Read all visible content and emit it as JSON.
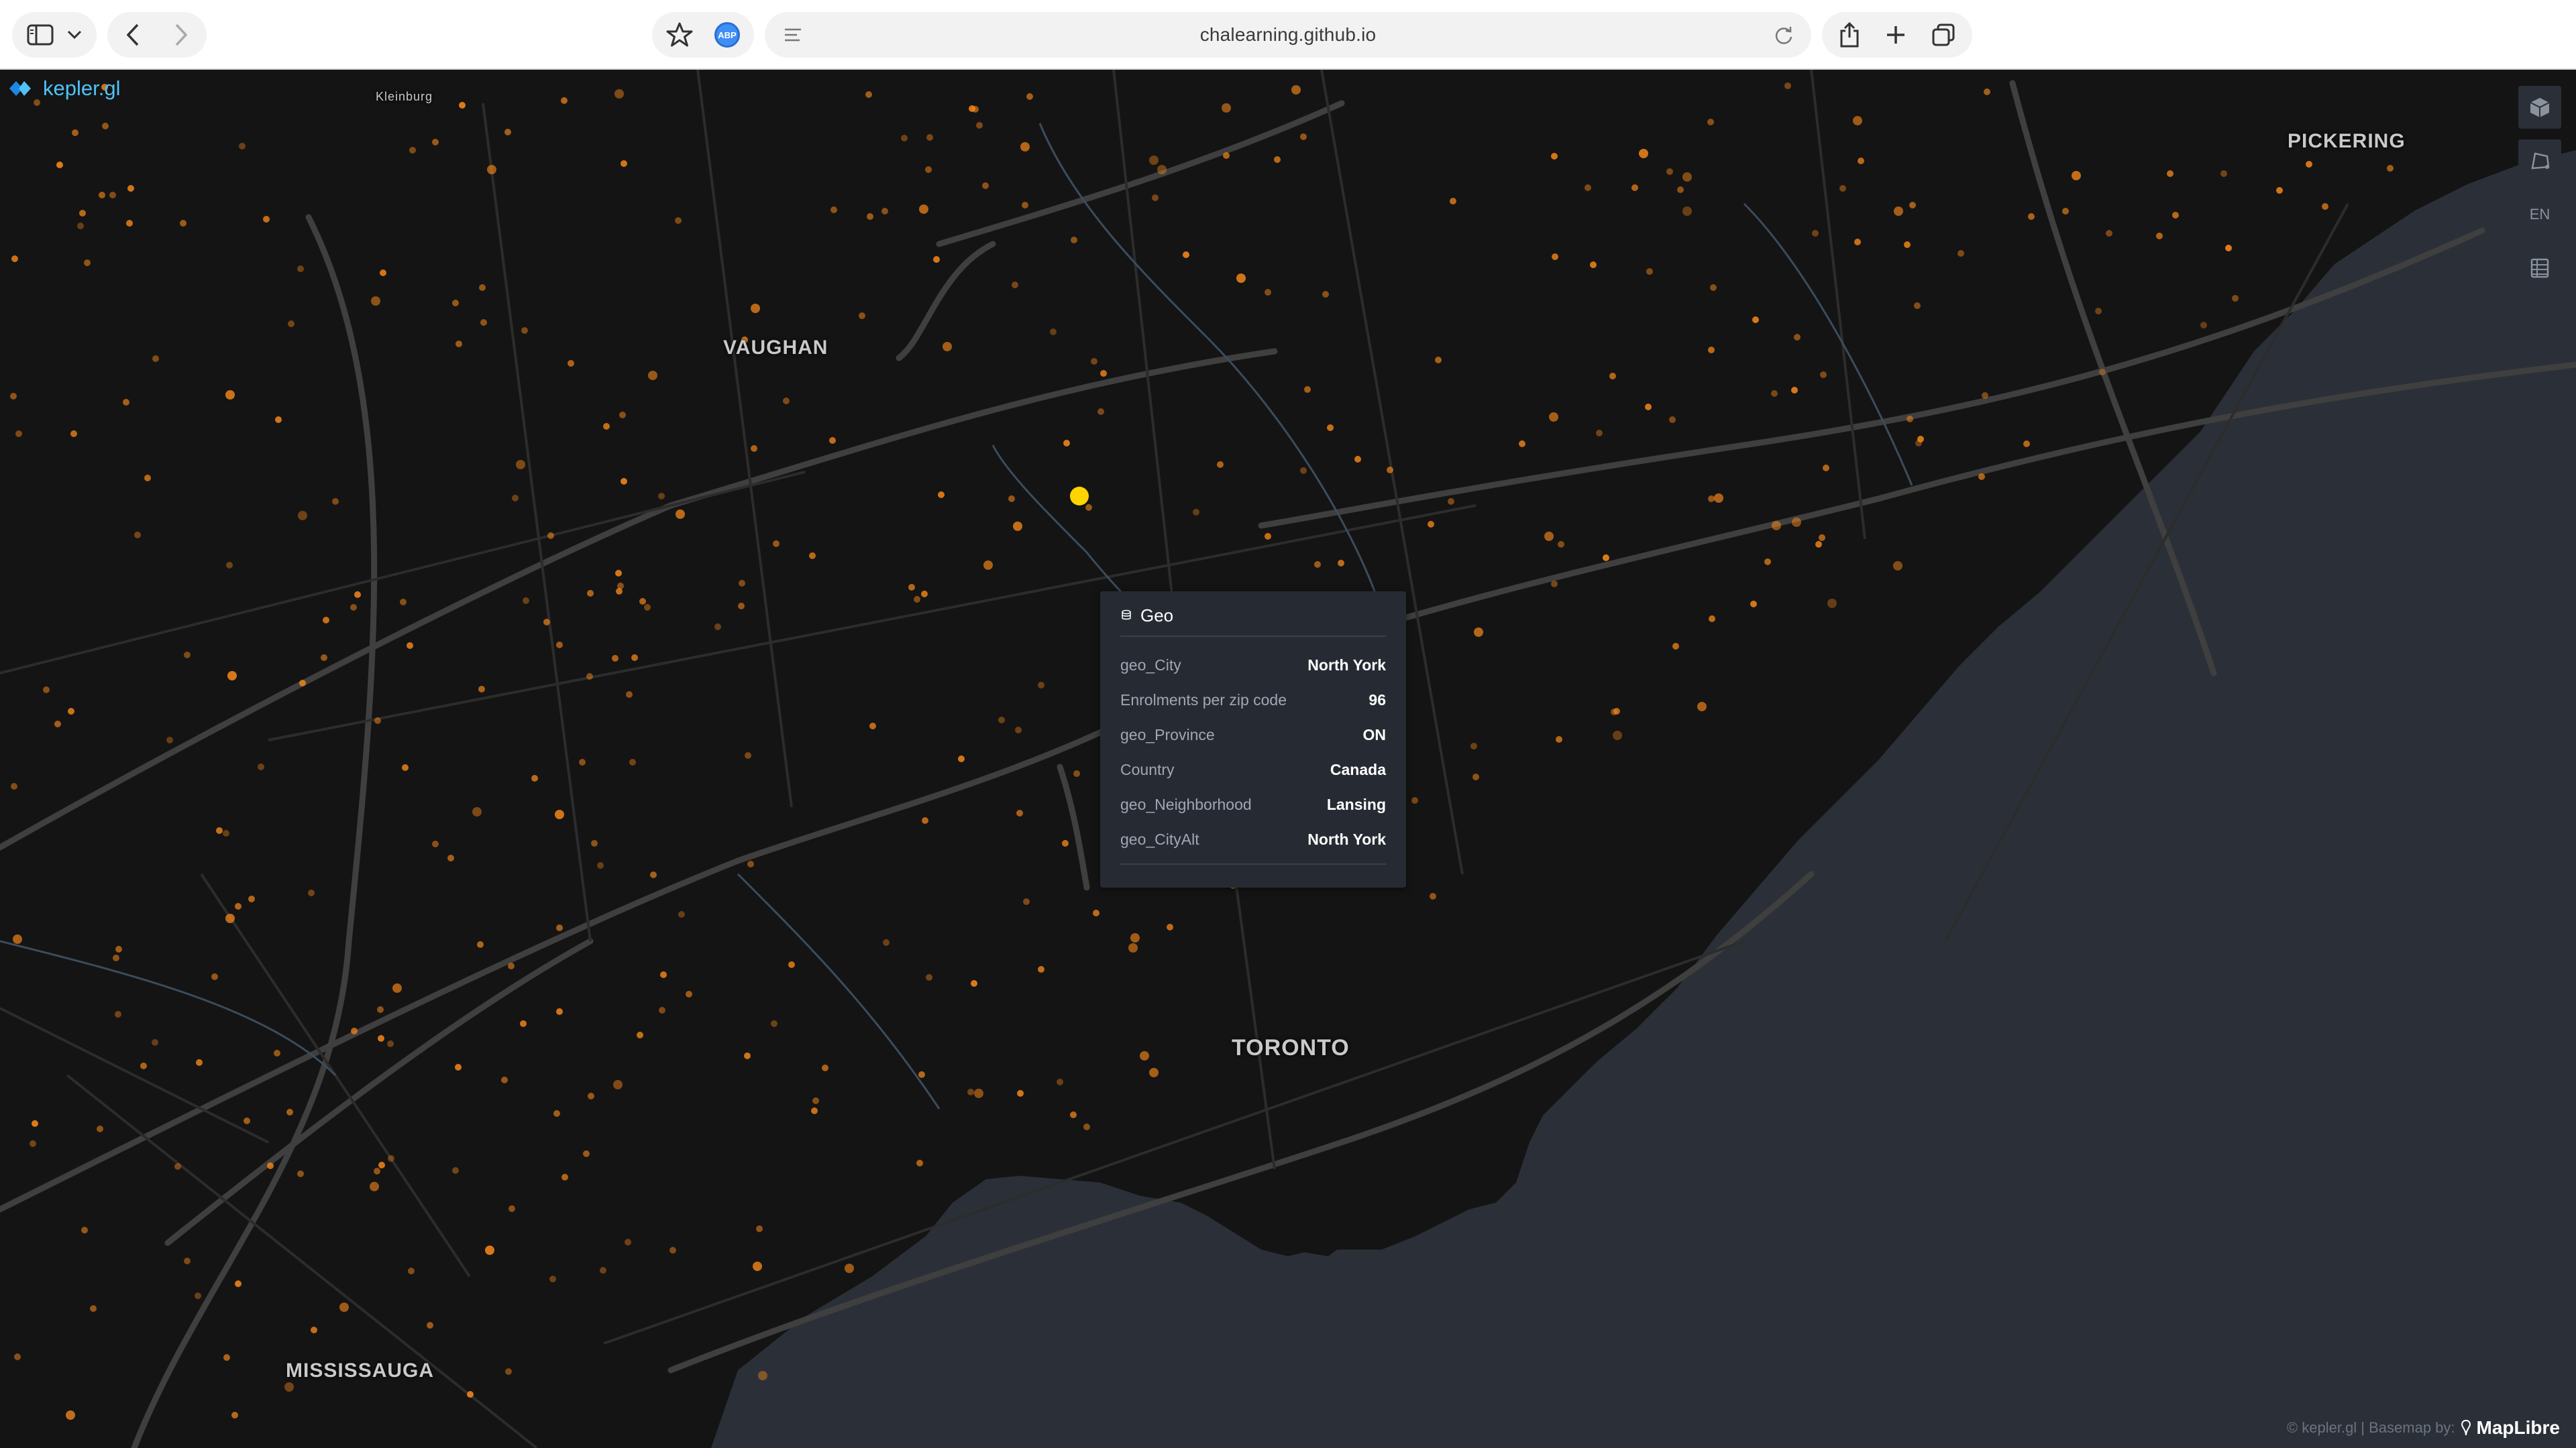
{
  "browser": {
    "url": "chalearning.github.io",
    "abp_label": "ABP"
  },
  "app": {
    "logo_text": "kepler.gl"
  },
  "map": {
    "labels": {
      "vaughan": "VAUGHAN",
      "toronto": "TORONTO",
      "mississauga": "MISSISSAUGA",
      "pickering": "PICKERING",
      "kleinburg": "Kleinburg"
    },
    "lang_button": "EN",
    "colors": {
      "land": "#141414",
      "water": "#2b3038",
      "road": "#3c3c3c",
      "point": "#ff8c1a",
      "highlight": "#ffd400"
    }
  },
  "tooltip": {
    "title": "Geo",
    "rows": [
      {
        "key": "geo_City",
        "value": "North York"
      },
      {
        "key": "Enrolments per zip code",
        "value": "96"
      },
      {
        "key": "geo_Province",
        "value": "ON"
      },
      {
        "key": "Country",
        "value": "Canada"
      },
      {
        "key": "geo_Neighborhood",
        "value": "Lansing"
      },
      {
        "key": "geo_CityAlt",
        "value": "North York"
      }
    ]
  },
  "attribution": {
    "text": "© kepler.gl | Basemap by:",
    "maplibre": "MapLibre"
  }
}
